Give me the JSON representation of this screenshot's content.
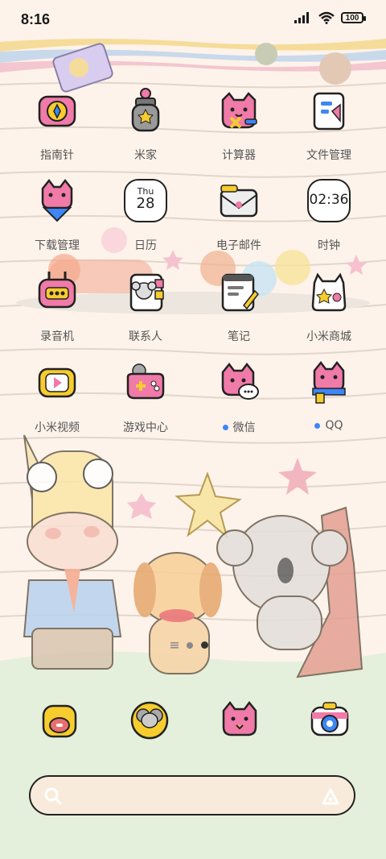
{
  "status_bar": {
    "time": "8:16",
    "battery": "100"
  },
  "apps": [
    {
      "label": "指南针",
      "icon": "compass-icon",
      "notification": false
    },
    {
      "label": "米家",
      "icon": "mijia-icon",
      "notification": false
    },
    {
      "label": "计算器",
      "icon": "calculator-icon",
      "notification": false
    },
    {
      "label": "文件管理",
      "icon": "file-manager-icon",
      "notification": false
    },
    {
      "label": "下载管理",
      "icon": "download-manager-icon",
      "notification": false
    },
    {
      "label": "日历",
      "icon": "calendar-icon",
      "notification": false,
      "weekday": "Thu",
      "day": "28"
    },
    {
      "label": "电子邮件",
      "icon": "email-icon",
      "notification": false
    },
    {
      "label": "时钟",
      "icon": "clock-icon",
      "notification": false,
      "time": "02:36"
    },
    {
      "label": "录音机",
      "icon": "recorder-icon",
      "notification": false
    },
    {
      "label": "联系人",
      "icon": "contacts-icon",
      "notification": false
    },
    {
      "label": "笔记",
      "icon": "notes-icon",
      "notification": false
    },
    {
      "label": "小米商城",
      "icon": "mi-store-icon",
      "notification": false
    },
    {
      "label": "小米视频",
      "icon": "mi-video-icon",
      "notification": false
    },
    {
      "label": "游戏中心",
      "icon": "game-center-icon",
      "notification": false
    },
    {
      "label": "微信",
      "icon": "wechat-icon",
      "notification": true
    },
    {
      "label": "QQ",
      "icon": "qq-icon",
      "notification": true
    }
  ],
  "dock": [
    {
      "icon": "phone-icon"
    },
    {
      "icon": "messages-icon"
    },
    {
      "icon": "browser-icon"
    },
    {
      "icon": "camera-icon"
    }
  ],
  "page_indicator": {
    "pages": 2,
    "current": 2
  },
  "search": {
    "icon": "search-icon",
    "assistant_icon": "assistant-icon"
  },
  "colors": {
    "background": "#fdf3ea",
    "ground": "#e5f0dc",
    "accent_pink": "#f07aa8",
    "accent_yellow": "#f7cc2e",
    "notification_dot": "#3d86f5"
  }
}
